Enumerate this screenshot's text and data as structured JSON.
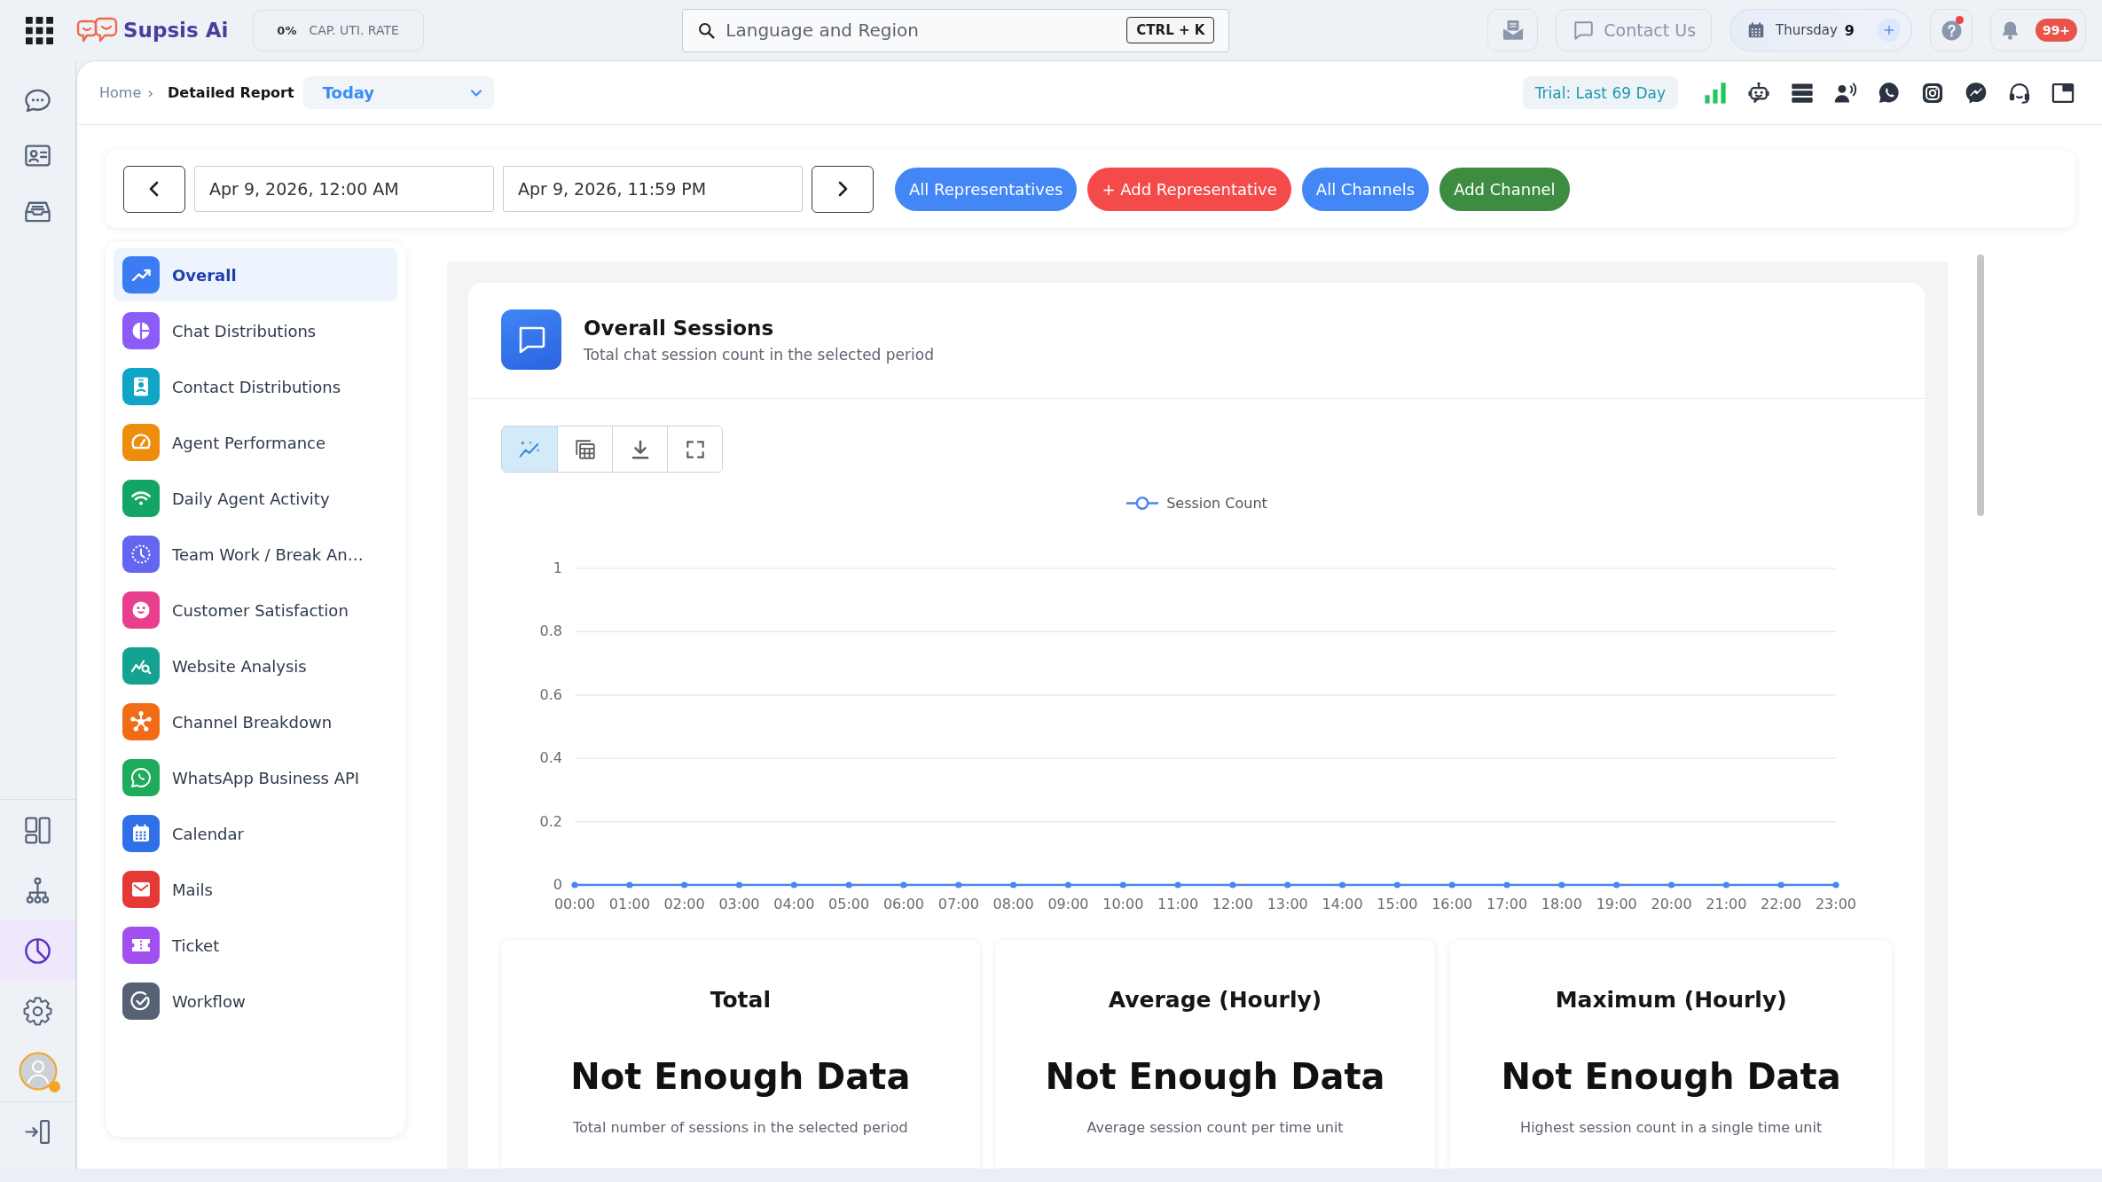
{
  "top_bar": {
    "brand": "Supsis Ai",
    "capacity": {
      "value": "0%",
      "label": "CAP. UTI. RATE"
    },
    "search": {
      "value": "Language and Region",
      "shortcut": "CTRL + K"
    },
    "contact_button": "Contact Us",
    "date_pill": {
      "day": "Thursday",
      "date": "9"
    },
    "help_alert": true,
    "notification_badge": "99+"
  },
  "nav_rail": {
    "top_items": [
      {
        "selected": false
      },
      {
        "selected": false
      },
      {
        "selected": false
      }
    ],
    "bottom_items": [
      {
        "selected": false
      },
      {
        "selected": false
      },
      {
        "selected": true
      },
      {
        "selected": false
      }
    ],
    "avatar": {
      "color": "#f5a524"
    }
  },
  "breadcrumb": {
    "items": [
      "Home",
      "Detailed Report"
    ],
    "separator": "›",
    "period": "Today"
  },
  "trial_badge": "Trial: Last 69 Day",
  "date_range": {
    "start": "Apr 9, 2026, 12:00 AM",
    "end": "Apr 9, 2026, 11:59 PM"
  },
  "actions": [
    {
      "label": "All Representatives",
      "color": "#4287f5"
    },
    {
      "label": "+ Add Representative",
      "color": "#f44a4a"
    },
    {
      "label": "All Channels",
      "color": "#4287f5"
    },
    {
      "label": "Add Channel",
      "color": "#3e8c41"
    }
  ],
  "report_menu": [
    {
      "label": "Overall",
      "color": "#3b7cf2",
      "selected": true
    },
    {
      "label": "Chat Distributions",
      "color": "#8b5cf6",
      "selected": false
    },
    {
      "label": "Contact Distributions",
      "color": "#0ea5c6",
      "selected": false
    },
    {
      "label": "Agent Performance",
      "color": "#ee8d0b",
      "selected": false
    },
    {
      "label": "Daily Agent Activity",
      "color": "#12a566",
      "selected": false
    },
    {
      "label": "Team Work / Break An…",
      "color": "#6366f1",
      "selected": false
    },
    {
      "label": "Customer Satisfaction",
      "color": "#e83e8c",
      "selected": false
    },
    {
      "label": "Website Analysis",
      "color": "#14a391",
      "selected": false
    },
    {
      "label": "Channel Breakdown",
      "color": "#f26c18",
      "selected": false
    },
    {
      "label": "WhatsApp Business API",
      "color": "#1faa5c",
      "selected": false
    },
    {
      "label": "Calendar",
      "color": "#2f6fe8",
      "selected": false
    },
    {
      "label": "Mails",
      "color": "#e53935",
      "selected": false
    },
    {
      "label": "Ticket",
      "color": "#a24ff0",
      "selected": false
    },
    {
      "label": "Workflow",
      "color": "#566174",
      "selected": false
    }
  ],
  "chart_card": {
    "title": "Overall Sessions",
    "subtitle": "Total chat session count in the selected period",
    "tools": [
      {
        "selected": true
      },
      {
        "selected": false
      },
      {
        "selected": false
      },
      {
        "selected": false
      }
    ],
    "chart_data": {
      "type": "line",
      "grid": true,
      "categories": [
        "00:00",
        "01:00",
        "02:00",
        "03:00",
        "04:00",
        "05:00",
        "06:00",
        "07:00",
        "08:00",
        "09:00",
        "10:00",
        "11:00",
        "12:00",
        "13:00",
        "14:00",
        "15:00",
        "16:00",
        "17:00",
        "18:00",
        "19:00",
        "20:00",
        "21:00",
        "22:00",
        "23:00"
      ],
      "series": [
        {
          "name": "Session Count",
          "color": "#4a86f0",
          "marker": "circle",
          "values": [
            0,
            0,
            0,
            0,
            0,
            0,
            0,
            0,
            0,
            0,
            0,
            0,
            0,
            0,
            0,
            0,
            0,
            0,
            0,
            0,
            0,
            0,
            0,
            0
          ]
        }
      ],
      "ylim": [
        0,
        1
      ],
      "yticks": [
        0,
        0.2,
        0.4,
        0.6,
        0.8,
        1
      ]
    }
  },
  "stats": [
    {
      "title": "Total",
      "value": "Not Enough Data",
      "description": "Total number of sessions in the selected period"
    },
    {
      "title": "Average (Hourly)",
      "value": "Not Enough Data",
      "description": "Average session count per time unit"
    },
    {
      "title": "Maximum (Hourly)",
      "value": "Not Enough Data",
      "description": "Highest session count in a single time unit"
    }
  ]
}
